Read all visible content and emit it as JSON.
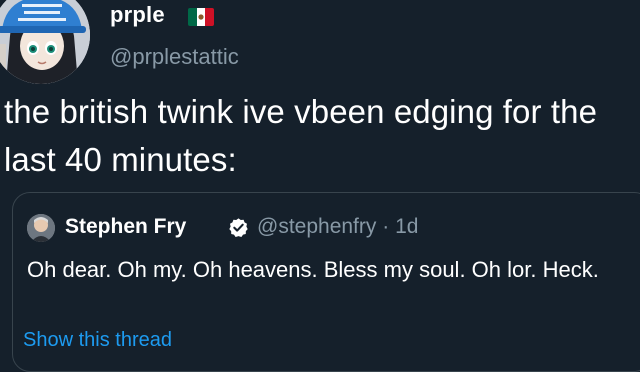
{
  "tweet": {
    "author_name": "prple",
    "author_handle": "@prplestattic",
    "text": "the british twink ive vbeen edging for the last 40 minutes:",
    "flag_icon": "mexico-flag-icon"
  },
  "quoted_tweet": {
    "author_name": "Stephen Fry",
    "author_handle": "@stephenfry",
    "separator": "·",
    "time": "1d",
    "text": "Oh dear. Oh my. Oh heavens. Bless my soul. Oh lor. Heck.",
    "show_thread_label": "Show this thread",
    "verified_icon": "verified-badge-icon"
  },
  "colors": {
    "background": "#15202b",
    "primary_text": "#ffffff",
    "secondary_text": "#8899a6",
    "link": "#1d9bf0",
    "border": "#38444d",
    "verified_badge": "#ffffff"
  }
}
